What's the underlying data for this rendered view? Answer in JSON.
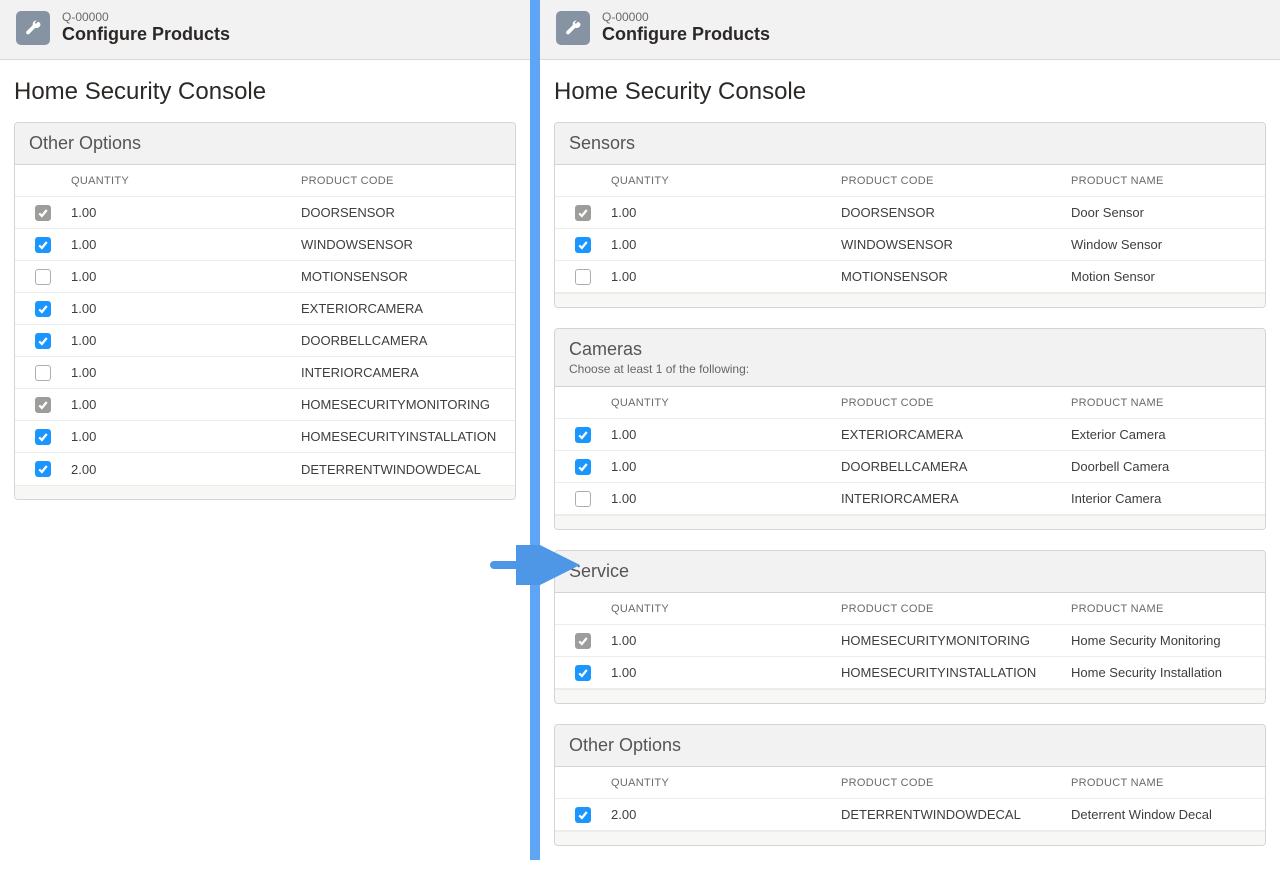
{
  "header": {
    "crumb": "Q-00000",
    "title": "Configure Products"
  },
  "page_title": "Home Security Console",
  "col": {
    "quantity": "QUANTITY",
    "product_code": "PRODUCT CODE",
    "product_name": "PRODUCT NAME"
  },
  "left": {
    "group": {
      "name": "Other Options",
      "rows": [
        {
          "state": "disabled",
          "qty": "1.00",
          "code": "DOORSENSOR"
        },
        {
          "state": "checked",
          "qty": "1.00",
          "code": "WINDOWSENSOR"
        },
        {
          "state": "unchecked",
          "qty": "1.00",
          "code": "MOTIONSENSOR"
        },
        {
          "state": "checked",
          "qty": "1.00",
          "code": "EXTERIORCAMERA"
        },
        {
          "state": "checked",
          "qty": "1.00",
          "code": "DOORBELLCAMERA"
        },
        {
          "state": "unchecked",
          "qty": "1.00",
          "code": "INTERIORCAMERA"
        },
        {
          "state": "disabled",
          "qty": "1.00",
          "code": "HOMESECURITYMONITORING"
        },
        {
          "state": "checked",
          "qty": "1.00",
          "code": "HOMESECURITYINSTALLATION"
        },
        {
          "state": "checked",
          "qty": "2.00",
          "code": "DETERRENTWINDOWDECAL"
        }
      ]
    }
  },
  "right": {
    "groups": [
      {
        "name": "Sensors",
        "rows": [
          {
            "state": "disabled",
            "qty": "1.00",
            "code": "DOORSENSOR",
            "pname": "Door Sensor"
          },
          {
            "state": "checked",
            "qty": "1.00",
            "code": "WINDOWSENSOR",
            "pname": "Window Sensor"
          },
          {
            "state": "unchecked",
            "qty": "1.00",
            "code": "MOTIONSENSOR",
            "pname": "Motion Sensor"
          }
        ]
      },
      {
        "name": "Cameras",
        "hint": "Choose at least 1 of the following:",
        "rows": [
          {
            "state": "checked",
            "qty": "1.00",
            "code": "EXTERIORCAMERA",
            "pname": "Exterior Camera"
          },
          {
            "state": "checked",
            "qty": "1.00",
            "code": "DOORBELLCAMERA",
            "pname": "Doorbell Camera"
          },
          {
            "state": "unchecked",
            "qty": "1.00",
            "code": "INTERIORCAMERA",
            "pname": "Interior Camera"
          }
        ]
      },
      {
        "name": "Service",
        "rows": [
          {
            "state": "disabled",
            "qty": "1.00",
            "code": "HOMESECURITYMONITORING",
            "pname": "Home Security Monitoring"
          },
          {
            "state": "checked",
            "qty": "1.00",
            "code": "HOMESECURITYINSTALLATION",
            "pname": "Home Security Installation"
          }
        ]
      },
      {
        "name": "Other Options",
        "rows": [
          {
            "state": "checked",
            "qty": "2.00",
            "code": "DETERRENTWINDOWDECAL",
            "pname": "Deterrent Window Decal"
          }
        ]
      }
    ]
  }
}
